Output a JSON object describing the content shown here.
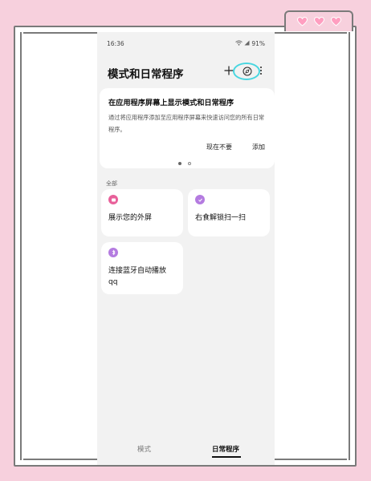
{
  "status_bar": {
    "time": "16:36",
    "battery": "91%"
  },
  "header": {
    "title": "模式和日常程序"
  },
  "banner": {
    "title": "在应用程序屏幕上显示模式和日常程序",
    "description": "通过将应用程序添加至应用程序屏幕来快速访问您的所有日常程序。",
    "later_label": "现在不要",
    "add_label": "添加"
  },
  "section": {
    "label": "全部"
  },
  "routines": [
    {
      "label": "展示您的外屏",
      "icon": "routine-icon",
      "color": "#e8609a"
    },
    {
      "label": "右食解锁扫一扫",
      "icon": "routine-icon",
      "color": "#b47be0"
    },
    {
      "label": "连接蓝牙自动播放qq",
      "line1": "连接蓝牙自动播放",
      "line2": "qq",
      "icon": "bluetooth-icon",
      "color": "#b47be0"
    }
  ],
  "tabs": {
    "modes": "模式",
    "routines": "日常程序",
    "active": "routines"
  },
  "colors": {
    "highlight_ring": "#48d6e0",
    "background": "#f7d0dd"
  }
}
